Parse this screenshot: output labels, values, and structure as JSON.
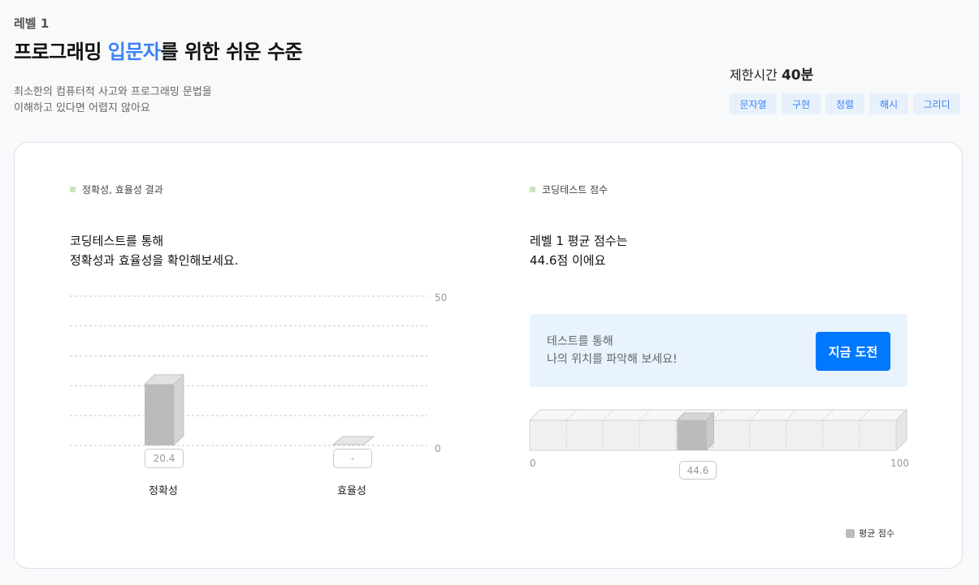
{
  "header": {
    "level": "레벨 1",
    "title_pre": "프로그래밍 ",
    "title_accent": "입문자",
    "title_post": "를 위한 쉬운 수준",
    "desc_line1": "최소한의 컴퓨터적 사고와 프로그래밍 문법을",
    "desc_line2": "이해하고 있다면 어렵지 않아요",
    "time_label": "제한시간 ",
    "time_value": "40분",
    "tags": [
      "문자열",
      "구현",
      "정렬",
      "해시",
      "그리디"
    ]
  },
  "left": {
    "section_label": "정확성, 효율성 결과",
    "lead_line1": "코딩테스트를 통해",
    "lead_line2": "정확성과 효율성을 확인해보세요.",
    "axis_max_label": "50",
    "axis_min_label": "0",
    "bar1_label": "정확성",
    "bar1_value": "20.4",
    "bar2_label": "효율성",
    "bar2_value": "-"
  },
  "right": {
    "section_label": "코딩테스트 점수",
    "lead_line1": "레벨 1 평균 점수는",
    "lead_line2": "44.6점 이에요",
    "cta_line1": "테스트를 통해",
    "cta_line2": "나의 위치를 파악해 보세요!",
    "cta_button": "지금 도전",
    "scale_min": "0",
    "scale_max": "100",
    "avg_value": "44.6",
    "legend": "평균 점수"
  },
  "chart_data": [
    {
      "type": "bar",
      "categories": [
        "정확성",
        "효율성"
      ],
      "values": [
        20.4,
        null
      ],
      "ylim": [
        0,
        50
      ],
      "grid": true
    },
    {
      "type": "bar",
      "categories": [
        "평균 점수"
      ],
      "values": [
        44.6
      ],
      "xlim": [
        0,
        100
      ]
    }
  ]
}
